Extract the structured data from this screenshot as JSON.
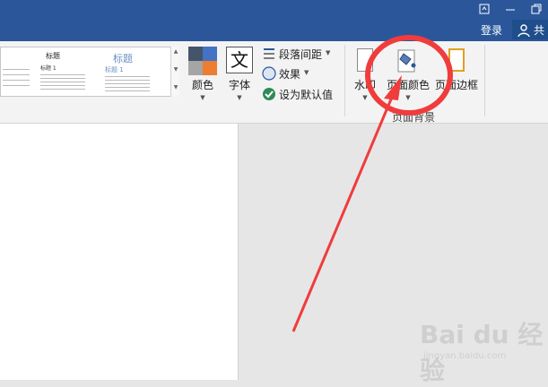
{
  "titlebar": {
    "signin_label": "登录",
    "share_label": "共"
  },
  "styles": {
    "thumb1_title": "标题",
    "thumb1_heading": "标题 1",
    "thumb2_title": "标题",
    "thumb2_heading": "标题 1"
  },
  "design": {
    "colors_label": "颜色",
    "fonts_label": "字体",
    "font_glyph": "文",
    "paragraph_spacing_label": "段落间距",
    "effects_label": "效果",
    "set_default_label": "设为默认值"
  },
  "page_background": {
    "watermark_label": "水印",
    "page_color_label": "页面颜色",
    "page_borders_label": "页面边框",
    "group_label": "页面背景"
  },
  "colors": {
    "titlebar": "#2b579a",
    "annotation": "#f03c3c",
    "palette": [
      "#44546a",
      "#4472c4",
      "#a5a5a5",
      "#ed7d31"
    ]
  },
  "watermark": {
    "brand": "Bai du 经验",
    "url": "jingyan.baidu.com"
  }
}
